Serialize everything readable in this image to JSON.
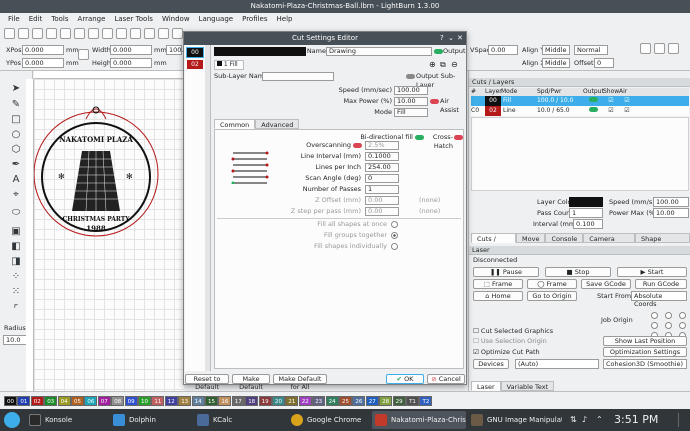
{
  "window": {
    "title": "Nakatomi-Plaza-Christmas-Ball.lbrn - LightBurn 1.3.00"
  },
  "menu": [
    "File",
    "Edit",
    "Tools",
    "Arrange",
    "Laser Tools",
    "Window",
    "Language",
    "Profiles",
    "Help"
  ],
  "toolbar": {
    "xpos_label": "XPos",
    "xpos": "0.000",
    "ypos_label": "YPos",
    "ypos": "0.000",
    "unit": "mm",
    "width_label": "Width",
    "width": "0.000",
    "height_label": "Height",
    "height": "0.000",
    "pct": "100.000",
    "vspace_label": "VSpace",
    "vspace": "0.00",
    "aligny_label": "Align Y",
    "aligny": "Middle",
    "alignx_label": "Align X",
    "alignx": "Middle",
    "offset_label": "Offset",
    "offset": "0",
    "normal": "Normal"
  },
  "left": {
    "radius_label": "Radius:",
    "radius": "10.0"
  },
  "design": {
    "title": "NAKATOMI PLAZA",
    "sub1": "CHRISTMAS PARTY",
    "sub2": "1988"
  },
  "dialog": {
    "title": "Cut Settings Editor",
    "layers": [
      "00",
      "02"
    ],
    "name_label": "Name",
    "name": "Drawing",
    "output": "Output",
    "sublayer_tab": "1 Fill",
    "sublayer_name_label": "Sub-Layer Name",
    "output_sublayer": "Output Sub-Layer",
    "speed_label": "Speed (mm/sec)",
    "speed": "100.00",
    "power_label": "Max Power (%)",
    "power": "10.00",
    "air_assist": "Air Assist",
    "mode_label": "Mode",
    "mode": "Fill",
    "tabs": [
      "Common",
      "Advanced"
    ],
    "bidir": "Bi-directional fill",
    "crosshatch": "Cross-Hatch",
    "overscan_label": "Overscanning",
    "overscan": "2.5%",
    "interval_label": "Line Interval (mm)",
    "interval": "0.1000",
    "lpi_label": "Lines per Inch",
    "lpi": "254.00",
    "angle_label": "Scan Angle (deg)",
    "angle": "0",
    "passes_label": "Number of Passes",
    "passes": "1",
    "zoffset_label": "Z Offset (mm)",
    "zoffset": "0.00",
    "zstep_label": "Z step per pass (mm)",
    "zstep": "0.00",
    "none": "(none)",
    "fill_all": "Fill all shapes at once",
    "fill_groups": "Fill groups together",
    "fill_indiv": "Fill shapes individually",
    "btn_reset": "Reset to Default",
    "btn_make": "Make Default",
    "btn_make_all": "Make Default for All",
    "btn_ok": "OK",
    "btn_cancel": "Cancel"
  },
  "cuts": {
    "title": "Cuts / Layers",
    "headers": [
      "#",
      "Layer",
      "Mode",
      "Spd/Pwr",
      "Output",
      "Show",
      "Air"
    ],
    "rows": [
      {
        "num": "",
        "layer": "00",
        "mode": "Fill",
        "spdpwr": "100.0 / 10.0",
        "color": "#101010"
      },
      {
        "num": "C0",
        "layer": "02",
        "mode": "Line",
        "spdpwr": "10.0 / 65.0",
        "color": "#b41a1a"
      }
    ],
    "layer_color_label": "Layer Color",
    "speed_label": "Speed (mm/s)",
    "speed": "100.00",
    "pass_label": "Pass Count",
    "pass": "1",
    "power_label": "Power Max (%)",
    "power": "10.00",
    "interval_label": "Interval (mm)",
    "interval": "0.100"
  },
  "right_tabs": [
    "Cuts / Layers",
    "Move",
    "Console",
    "Camera Control",
    "Shape Properties"
  ],
  "laser": {
    "title": "Laser",
    "status": "Disconnected",
    "pause": "Pause",
    "stop": "Stop",
    "start": "Start",
    "frame1": "Frame",
    "frame2": "Frame",
    "save_gcode": "Save GCode",
    "run_gcode": "Run GCode",
    "home": "Home",
    "goto_origin": "Go to Origin",
    "start_from_label": "Start From:",
    "start_from": "Absolute Coords",
    "job_origin": "Job Origin",
    "cut_selected": "Cut Selected Graphics",
    "use_selection": "Use Selection Origin",
    "show_last": "Show Last Position",
    "optimize": "Optimize Cut Path",
    "opt_settings": "Optimization Settings",
    "devices": "Devices",
    "auto": "(Auto)",
    "device": "Cohesion3D (Smoothie)"
  },
  "bottom_tabs": [
    "Laser",
    "Variable Text"
  ],
  "palette": [
    {
      "l": "00",
      "c": "#101010"
    },
    {
      "l": "01",
      "c": "#1f3fb0"
    },
    {
      "l": "02",
      "c": "#b41a1a"
    },
    {
      "l": "03",
      "c": "#1e8c2d"
    },
    {
      "l": "04",
      "c": "#9a9a24"
    },
    {
      "l": "05",
      "c": "#b06020"
    },
    {
      "l": "06",
      "c": "#1da6b8"
    },
    {
      "l": "07",
      "c": "#a020a0"
    },
    {
      "l": "08",
      "c": "#909090"
    },
    {
      "l": "09",
      "c": "#3050d0"
    },
    {
      "l": "10",
      "c": "#2aa02a"
    },
    {
      "l": "11",
      "c": "#c06060"
    },
    {
      "l": "12",
      "c": "#4040a0"
    },
    {
      "l": "13",
      "c": "#a08040"
    },
    {
      "l": "14",
      "c": "#6080a0"
    },
    {
      "l": "15",
      "c": "#306030"
    },
    {
      "l": "16",
      "c": "#c09060"
    },
    {
      "l": "17",
      "c": "#6a6a6a"
    },
    {
      "l": "18",
      "c": "#504080"
    },
    {
      "l": "19",
      "c": "#8a3a3a"
    },
    {
      "l": "20",
      "c": "#3a8a8a"
    },
    {
      "l": "21",
      "c": "#807030"
    },
    {
      "l": "22",
      "c": "#a040c0"
    },
    {
      "l": "23",
      "c": "#606080"
    },
    {
      "l": "24",
      "c": "#308060"
    },
    {
      "l": "25",
      "c": "#a05030"
    },
    {
      "l": "26",
      "c": "#5070a0"
    },
    {
      "l": "27",
      "c": "#2060c0"
    },
    {
      "l": "28",
      "c": "#80a040"
    },
    {
      "l": "29",
      "c": "#406040"
    },
    {
      "l": "T1",
      "c": "#505050"
    },
    {
      "l": "T2",
      "c": "#3060c0"
    }
  ],
  "taskbar": {
    "items": [
      {
        "label": "Konsole",
        "c": "#2a2a2a"
      },
      {
        "label": "Dolphin",
        "c": "#3a8ed8"
      },
      {
        "label": "KCalc",
        "c": "#4a6a9a"
      },
      {
        "label": "Google Chrome",
        "c": "#d9a21b"
      },
      {
        "label": "Nakatomi-Plaza-Christ...",
        "c": "#c23a2a"
      },
      {
        "label": "GNU Image Manipulati...",
        "c": "#6b5a45"
      }
    ],
    "clock": "3:51 PM"
  }
}
